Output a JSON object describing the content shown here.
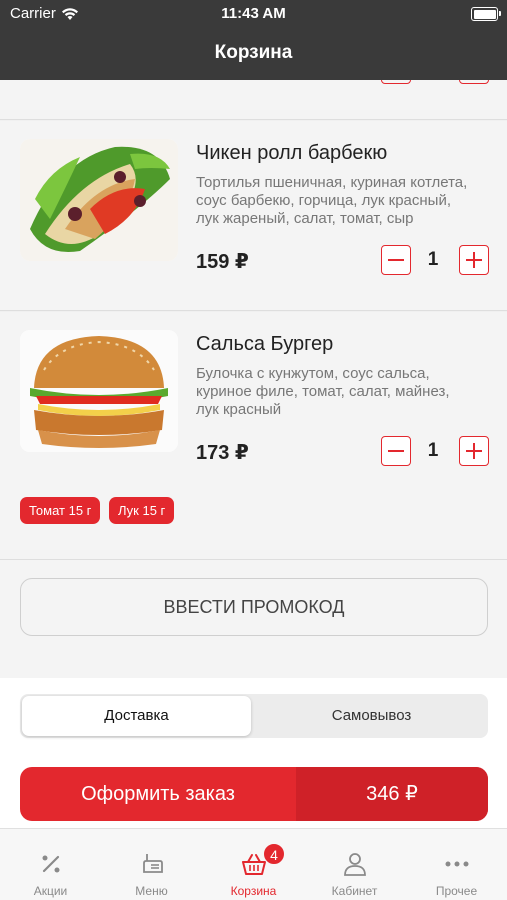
{
  "status_bar": {
    "carrier": "Carrier",
    "time": "11:43 AM"
  },
  "nav": {
    "title": "Корзина"
  },
  "cart_items": [
    {
      "name": "Чикен ролл барбекю",
      "description": [
        "Тортилья пшеничная, куриная котлета,",
        "соус барбекю, горчица, лук красный,",
        "лук жареный, салат, томат, сыр"
      ],
      "price": "159 ₽",
      "quantity": "1",
      "image_icon": "chicken-roll-photo"
    },
    {
      "name": "Сальса Бургер",
      "description": [
        "Булочка с кунжутом, соус сальса,",
        "куриное филе, томат, салат, майнез,",
        "лук красный"
      ],
      "price": "173 ₽",
      "quantity": "1",
      "image_icon": "salsa-burger-photo",
      "modifiers": [
        "Томат 15 г",
        "Лук 15 г"
      ]
    }
  ],
  "promo": {
    "label": "ВВЕСТИ ПРОМОКОД"
  },
  "delivery_switch": {
    "options": [
      "Доставка",
      "Самовывоз"
    ],
    "selected": "Доставка"
  },
  "checkout": {
    "label": "Оформить заказ",
    "total": "346 ₽"
  },
  "tabbar": {
    "items": [
      {
        "label": "Акции",
        "icon": "percent-icon"
      },
      {
        "label": "Меню",
        "icon": "menu-icon"
      },
      {
        "label": "Корзина",
        "icon": "basket-icon",
        "badge": "4",
        "active": true
      },
      {
        "label": "Кабинет",
        "icon": "user-icon"
      },
      {
        "label": "Прочее",
        "icon": "more-icon"
      }
    ]
  },
  "colors": {
    "accent": "#e3282e",
    "header": "#3a3a3a",
    "inactive": "#8a8a8a"
  }
}
